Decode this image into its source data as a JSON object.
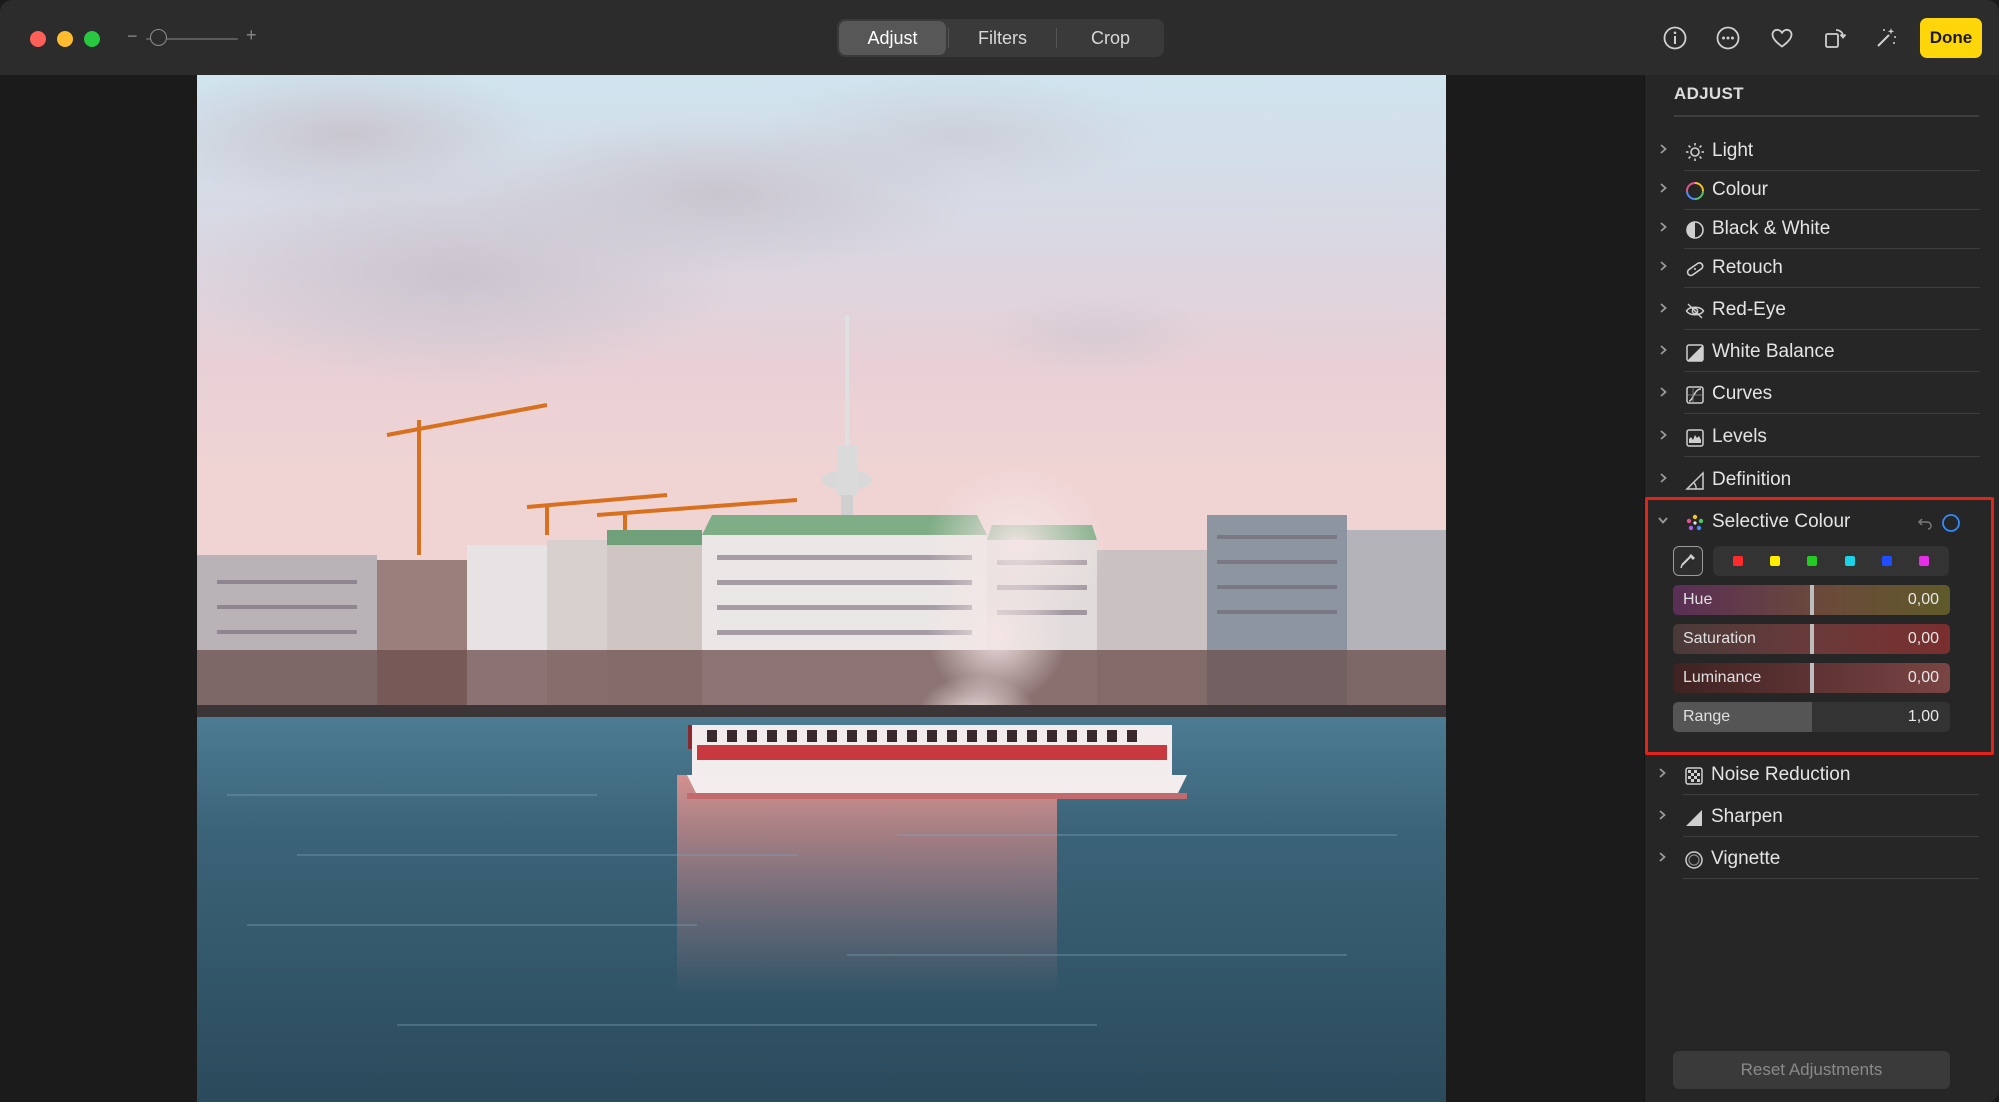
{
  "toolbar": {
    "zoom_minus": "−",
    "zoom_plus": "+",
    "zoom_level": 0.05,
    "tabs": [
      {
        "label": "Adjust",
        "active": true
      },
      {
        "label": "Filters",
        "active": false
      },
      {
        "label": "Crop",
        "active": false
      }
    ],
    "icons": [
      "info-icon",
      "more-icon",
      "heart-icon",
      "rotate-icon",
      "auto-enhance-icon"
    ],
    "done_label": "Done",
    "done_color": "#ffd60a"
  },
  "sidebar": {
    "header": "ADJUST",
    "items": [
      {
        "label": "Light",
        "icon": "sun-icon"
      },
      {
        "label": "Colour",
        "icon": "colour-wheel-icon"
      },
      {
        "label": "Black & White",
        "icon": "half-circle-icon"
      },
      {
        "label": "Retouch",
        "icon": "bandage-icon"
      },
      {
        "label": "Red-Eye",
        "icon": "eye-icon"
      },
      {
        "label": "White Balance",
        "icon": "white-balance-icon"
      },
      {
        "label": "Curves",
        "icon": "curves-icon"
      },
      {
        "label": "Levels",
        "icon": "levels-icon"
      },
      {
        "label": "Definition",
        "icon": "definition-icon"
      }
    ],
    "selective_colour": {
      "label": "Selective Colour",
      "expanded": true,
      "swatches": [
        "#ff2a2a",
        "#ffee00",
        "#22cc22",
        "#19d3e6",
        "#1f4dff",
        "#e62ee6"
      ],
      "sliders": [
        {
          "label": "Hue",
          "value": "0,00",
          "level": 0.5
        },
        {
          "label": "Saturation",
          "value": "0,00",
          "level": 0.5
        },
        {
          "label": "Luminance",
          "value": "0,00",
          "level": 0.5
        },
        {
          "label": "Range",
          "value": "1,00",
          "level": 0.5
        }
      ]
    },
    "items_after": [
      {
        "label": "Noise Reduction",
        "icon": "noise-icon"
      },
      {
        "label": "Sharpen",
        "icon": "sharpen-icon"
      },
      {
        "label": "Vignette",
        "icon": "vignette-icon"
      }
    ],
    "reset_label": "Reset Adjustments",
    "highlight_color": "#e3231a"
  }
}
